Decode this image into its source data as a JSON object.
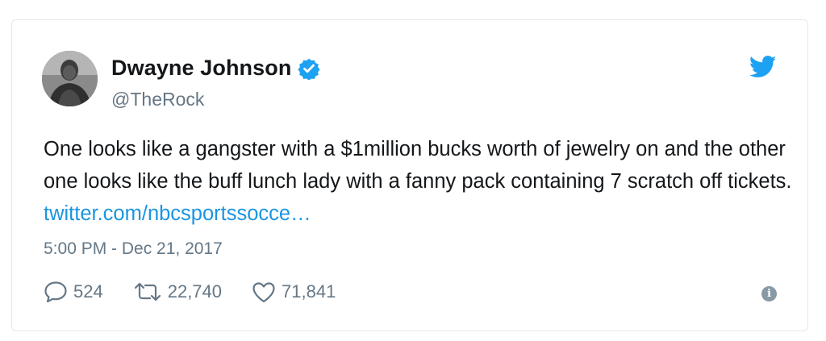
{
  "tweet": {
    "author": {
      "display_name": "Dwayne Johnson",
      "handle": "@TheRock",
      "verified": true
    },
    "text": "One looks like a gangster with a $1million bucks worth of jewelry on and the other one looks like the buff lunch lady with a fanny pack containing 7 scratch off tickets.",
    "link_text": "twitter.com/nbcsportssocce…",
    "timestamp": "5:00 PM - Dec 21, 2017",
    "stats": {
      "replies": "524",
      "retweets": "22,740",
      "likes": "71,841"
    }
  },
  "icons": {
    "reply": "reply-icon",
    "retweet": "retweet-icon",
    "like": "heart-icon",
    "info": "info-icon",
    "brand": "twitter-bird-icon",
    "verified": "verified-badge-icon"
  },
  "colors": {
    "brand_blue": "#1da1f2",
    "link_blue": "#1b95e0",
    "secondary_gray": "#657786"
  }
}
